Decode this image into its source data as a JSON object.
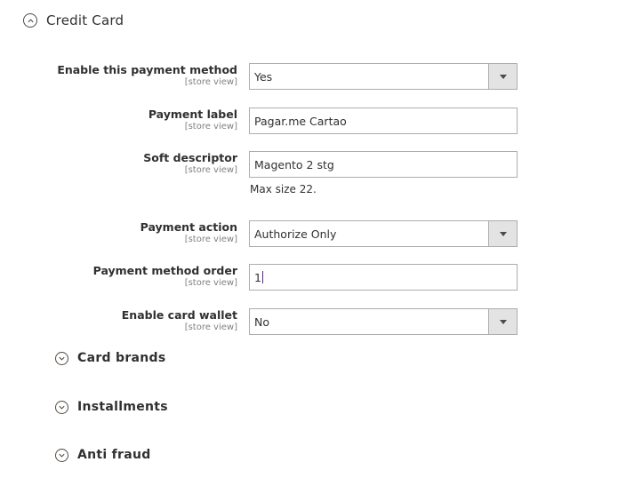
{
  "section": {
    "title": "Credit Card",
    "expanded": true,
    "icon": "chevron-up-circle-icon"
  },
  "fields": [
    {
      "label": "Enable this payment method",
      "scope": "[store view]",
      "type": "select",
      "value": "Yes"
    },
    {
      "label": "Payment label",
      "scope": "[store view]",
      "type": "text",
      "value": "Pagar.me Cartao"
    },
    {
      "label": "Soft descriptor",
      "scope": "[store view]",
      "type": "text",
      "value": "Magento 2 stg",
      "note": "Max size 22."
    },
    {
      "label": "Payment action",
      "scope": "[store view]",
      "type": "select",
      "value": "Authorize Only"
    },
    {
      "label": "Payment method order",
      "scope": "[store view]",
      "type": "text",
      "value": "1"
    },
    {
      "label": "Enable card wallet",
      "scope": "[store view]",
      "type": "select",
      "value": "No"
    }
  ],
  "subsections": [
    {
      "title": "Card brands",
      "expanded": false,
      "icon": "chevron-down-circle-icon"
    },
    {
      "title": "Installments",
      "expanded": false,
      "icon": "chevron-down-circle-icon"
    },
    {
      "title": "Anti fraud",
      "expanded": false,
      "icon": "chevron-down-circle-icon"
    }
  ]
}
